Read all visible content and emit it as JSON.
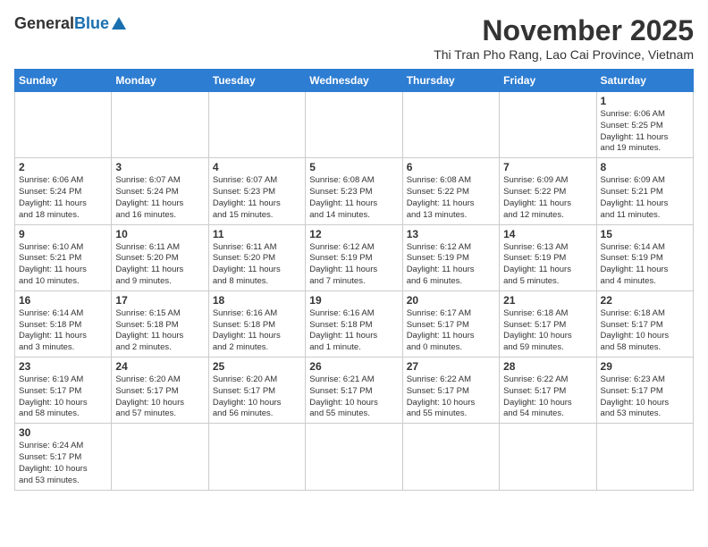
{
  "header": {
    "logo": {
      "general": "General",
      "blue": "Blue"
    },
    "title": "November 2025",
    "subtitle": "Thi Tran Pho Rang, Lao Cai Province, Vietnam"
  },
  "weekdays": [
    "Sunday",
    "Monday",
    "Tuesday",
    "Wednesday",
    "Thursday",
    "Friday",
    "Saturday"
  ],
  "weeks": [
    [
      {
        "day": "",
        "info": ""
      },
      {
        "day": "",
        "info": ""
      },
      {
        "day": "",
        "info": ""
      },
      {
        "day": "",
        "info": ""
      },
      {
        "day": "",
        "info": ""
      },
      {
        "day": "",
        "info": ""
      },
      {
        "day": "1",
        "info": "Sunrise: 6:06 AM\nSunset: 5:25 PM\nDaylight: 11 hours\nand 19 minutes."
      }
    ],
    [
      {
        "day": "2",
        "info": "Sunrise: 6:06 AM\nSunset: 5:24 PM\nDaylight: 11 hours\nand 18 minutes."
      },
      {
        "day": "3",
        "info": "Sunrise: 6:07 AM\nSunset: 5:24 PM\nDaylight: 11 hours\nand 16 minutes."
      },
      {
        "day": "4",
        "info": "Sunrise: 6:07 AM\nSunset: 5:23 PM\nDaylight: 11 hours\nand 15 minutes."
      },
      {
        "day": "5",
        "info": "Sunrise: 6:08 AM\nSunset: 5:23 PM\nDaylight: 11 hours\nand 14 minutes."
      },
      {
        "day": "6",
        "info": "Sunrise: 6:08 AM\nSunset: 5:22 PM\nDaylight: 11 hours\nand 13 minutes."
      },
      {
        "day": "7",
        "info": "Sunrise: 6:09 AM\nSunset: 5:22 PM\nDaylight: 11 hours\nand 12 minutes."
      },
      {
        "day": "8",
        "info": "Sunrise: 6:09 AM\nSunset: 5:21 PM\nDaylight: 11 hours\nand 11 minutes."
      }
    ],
    [
      {
        "day": "9",
        "info": "Sunrise: 6:10 AM\nSunset: 5:21 PM\nDaylight: 11 hours\nand 10 minutes."
      },
      {
        "day": "10",
        "info": "Sunrise: 6:11 AM\nSunset: 5:20 PM\nDaylight: 11 hours\nand 9 minutes."
      },
      {
        "day": "11",
        "info": "Sunrise: 6:11 AM\nSunset: 5:20 PM\nDaylight: 11 hours\nand 8 minutes."
      },
      {
        "day": "12",
        "info": "Sunrise: 6:12 AM\nSunset: 5:19 PM\nDaylight: 11 hours\nand 7 minutes."
      },
      {
        "day": "13",
        "info": "Sunrise: 6:12 AM\nSunset: 5:19 PM\nDaylight: 11 hours\nand 6 minutes."
      },
      {
        "day": "14",
        "info": "Sunrise: 6:13 AM\nSunset: 5:19 PM\nDaylight: 11 hours\nand 5 minutes."
      },
      {
        "day": "15",
        "info": "Sunrise: 6:14 AM\nSunset: 5:19 PM\nDaylight: 11 hours\nand 4 minutes."
      }
    ],
    [
      {
        "day": "16",
        "info": "Sunrise: 6:14 AM\nSunset: 5:18 PM\nDaylight: 11 hours\nand 3 minutes."
      },
      {
        "day": "17",
        "info": "Sunrise: 6:15 AM\nSunset: 5:18 PM\nDaylight: 11 hours\nand 2 minutes."
      },
      {
        "day": "18",
        "info": "Sunrise: 6:16 AM\nSunset: 5:18 PM\nDaylight: 11 hours\nand 2 minutes."
      },
      {
        "day": "19",
        "info": "Sunrise: 6:16 AM\nSunset: 5:18 PM\nDaylight: 11 hours\nand 1 minute."
      },
      {
        "day": "20",
        "info": "Sunrise: 6:17 AM\nSunset: 5:17 PM\nDaylight: 11 hours\nand 0 minutes."
      },
      {
        "day": "21",
        "info": "Sunrise: 6:18 AM\nSunset: 5:17 PM\nDaylight: 10 hours\nand 59 minutes."
      },
      {
        "day": "22",
        "info": "Sunrise: 6:18 AM\nSunset: 5:17 PM\nDaylight: 10 hours\nand 58 minutes."
      }
    ],
    [
      {
        "day": "23",
        "info": "Sunrise: 6:19 AM\nSunset: 5:17 PM\nDaylight: 10 hours\nand 58 minutes."
      },
      {
        "day": "24",
        "info": "Sunrise: 6:20 AM\nSunset: 5:17 PM\nDaylight: 10 hours\nand 57 minutes."
      },
      {
        "day": "25",
        "info": "Sunrise: 6:20 AM\nSunset: 5:17 PM\nDaylight: 10 hours\nand 56 minutes."
      },
      {
        "day": "26",
        "info": "Sunrise: 6:21 AM\nSunset: 5:17 PM\nDaylight: 10 hours\nand 55 minutes."
      },
      {
        "day": "27",
        "info": "Sunrise: 6:22 AM\nSunset: 5:17 PM\nDaylight: 10 hours\nand 55 minutes."
      },
      {
        "day": "28",
        "info": "Sunrise: 6:22 AM\nSunset: 5:17 PM\nDaylight: 10 hours\nand 54 minutes."
      },
      {
        "day": "29",
        "info": "Sunrise: 6:23 AM\nSunset: 5:17 PM\nDaylight: 10 hours\nand 53 minutes."
      }
    ],
    [
      {
        "day": "30",
        "info": "Sunrise: 6:24 AM\nSunset: 5:17 PM\nDaylight: 10 hours\nand 53 minutes."
      },
      {
        "day": "",
        "info": ""
      },
      {
        "day": "",
        "info": ""
      },
      {
        "day": "",
        "info": ""
      },
      {
        "day": "",
        "info": ""
      },
      {
        "day": "",
        "info": ""
      },
      {
        "day": "",
        "info": ""
      }
    ]
  ]
}
